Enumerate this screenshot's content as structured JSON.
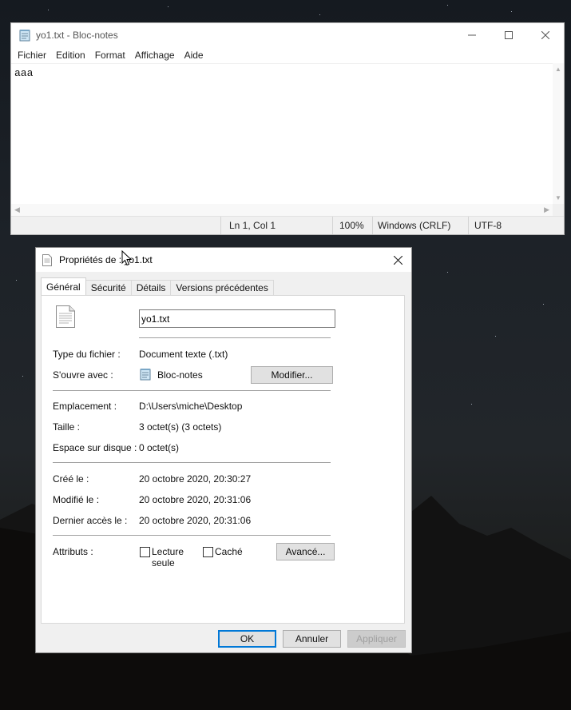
{
  "notepad": {
    "title": "yo1.txt - Bloc-notes",
    "menu": [
      "Fichier",
      "Edition",
      "Format",
      "Affichage",
      "Aide"
    ],
    "content": "aaa",
    "status": {
      "position": "Ln 1, Col 1",
      "zoom": "100%",
      "line_endings": "Windows (CRLF)",
      "encoding": "UTF-8"
    }
  },
  "dialog": {
    "title": "Propriétés de : yo1.txt",
    "tabs": [
      "Général",
      "Sécurité",
      "Détails",
      "Versions précédentes"
    ],
    "filename": "yo1.txt",
    "file_type_label": "Type du fichier :",
    "file_type_value": "Document texte (.txt)",
    "opens_with_label": "S'ouvre avec :",
    "opens_with_value": "Bloc-notes",
    "modify_button": "Modifier...",
    "location_label": "Emplacement :",
    "location_value": "D:\\Users\\miche\\Desktop",
    "size_label": "Taille :",
    "size_value": "3 octet(s) (3 octets)",
    "disk_size_label": "Espace sur disque :",
    "disk_size_value": "0 octet(s)",
    "created_label": "Créé le :",
    "created_value": "20 octobre 2020, 20:30:27",
    "modified_label": "Modifié le :",
    "modified_value": "20 octobre 2020, 20:31:06",
    "accessed_label": "Dernier accès le :",
    "accessed_value": "20 octobre 2020, 20:31:06",
    "attributes_label": "Attributs :",
    "readonly_label_1": "Lecture",
    "readonly_label_2": "seule",
    "hidden_label": "Caché",
    "advanced_button": "Avancé...",
    "ok_button": "OK",
    "cancel_button": "Annuler",
    "apply_button": "Appliquer"
  }
}
